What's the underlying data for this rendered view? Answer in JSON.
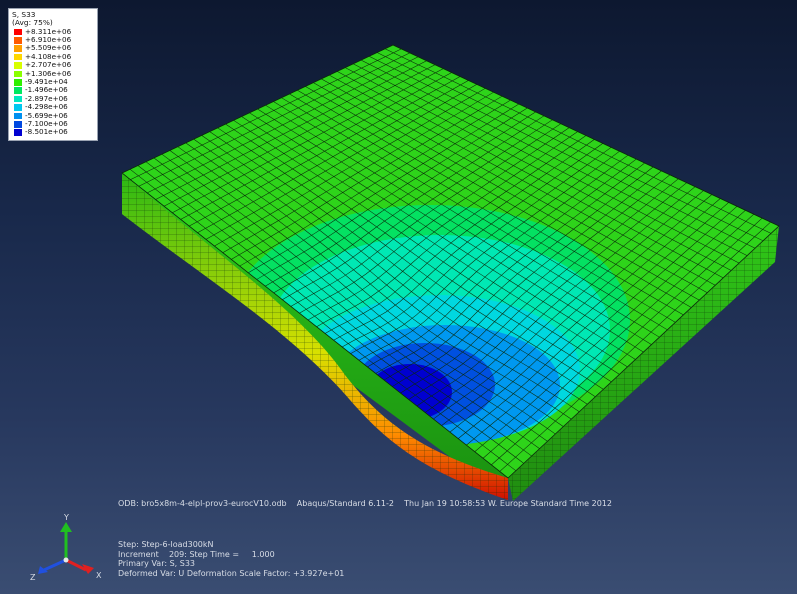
{
  "legend": {
    "title": "S, S33",
    "avg": "(Avg: 75%)",
    "entries": [
      {
        "label": "+8.311e+06",
        "color": "#ff0000"
      },
      {
        "label": "+6.910e+06",
        "color": "#ff5a00"
      },
      {
        "label": "+5.509e+06",
        "color": "#ffa000"
      },
      {
        "label": "+4.108e+06",
        "color": "#ffd800"
      },
      {
        "label": "+2.707e+06",
        "color": "#d8ff00"
      },
      {
        "label": "+1.306e+06",
        "color": "#8aff00"
      },
      {
        "label": "-9.491e+04",
        "color": "#2ef000"
      },
      {
        "label": "-1.496e+06",
        "color": "#00e860"
      },
      {
        "label": "-2.897e+06",
        "color": "#00e8c0"
      },
      {
        "label": "-4.298e+06",
        "color": "#00c8f0"
      },
      {
        "label": "-5.699e+06",
        "color": "#0090f0"
      },
      {
        "label": "-7.100e+06",
        "color": "#0048e0"
      },
      {
        "label": "-8.501e+06",
        "color": "#0000d0"
      }
    ]
  },
  "info": {
    "odb": "ODB: bro5x8m-4-elpl-prov3-eurocV10.odb",
    "solver": "Abaqus/Standard 6.11-2",
    "timestamp": "Thu Jan 19 10:58:53 W. Europe Standard Time 2012",
    "step": "Step: Step-6-load300kN",
    "increment": "Increment    209: Step Time =     1.000",
    "primary_var": "Primary Var: S, S33",
    "deformed_var": "Deformed Var: U   Deformation Scale Factor: +3.927e+01"
  },
  "triad": {
    "x_label": "X",
    "y_label": "Y",
    "z_label": "Z",
    "x_color": "#e02020",
    "y_color": "#20c020",
    "z_color": "#2050e0"
  },
  "colors": {
    "plate_top": "#2ed41a",
    "mesh_line": "#0a2a0a"
  }
}
